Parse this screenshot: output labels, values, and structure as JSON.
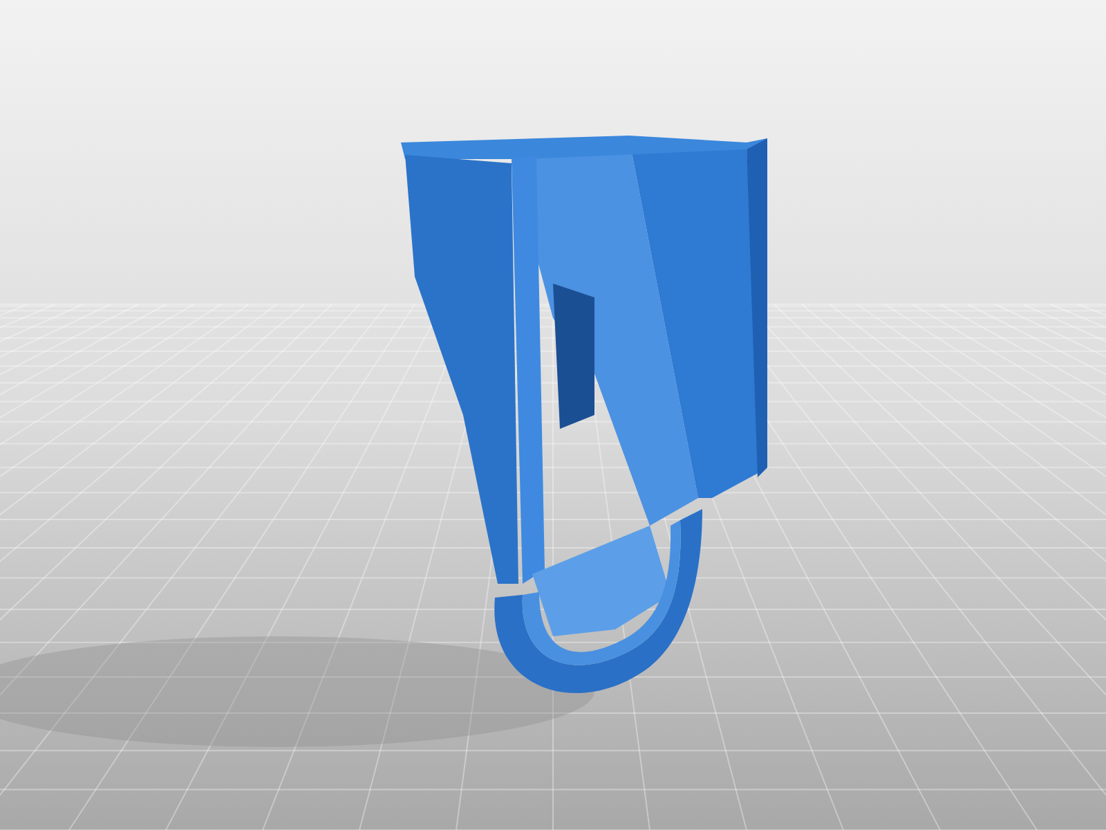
{
  "scene": {
    "kind": "render"
  }
}
